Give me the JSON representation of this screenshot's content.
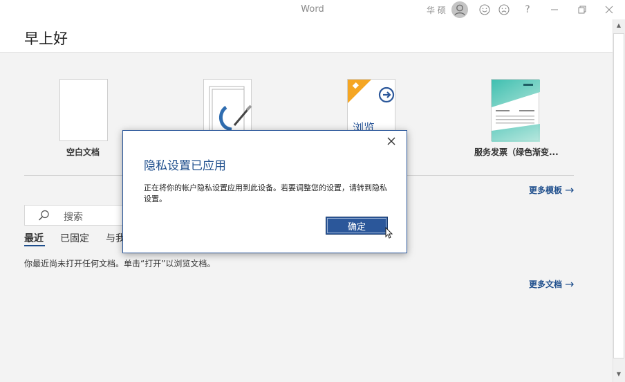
{
  "window": {
    "app_title": "Word",
    "user_name": "华 硕"
  },
  "title_icons": [
    "user-avatar-icon",
    "smile-icon",
    "frown-icon",
    "help-icon",
    "minimize-icon",
    "restore-icon",
    "close-icon"
  ],
  "title_help": "?",
  "greeting": "早上好",
  "templates": [
    {
      "label": "空白文档"
    },
    {
      "label": ""
    },
    {
      "label": "浏览"
    },
    {
      "label": "服务发票（绿色渐变..."
    }
  ],
  "more_templates": "更多模板",
  "search": {
    "placeholder": "搜索"
  },
  "tabs": [
    {
      "label": "最近"
    },
    {
      "label": "已固定"
    },
    {
      "label": "与我"
    }
  ],
  "empty_message": "你最近尚未打开任何文档。单击“打开”以浏览文档。",
  "more_documents": "更多文档",
  "dialog": {
    "title": "隐私设置已应用",
    "message": "正在将你的帐户隐私设置应用到此设备。若要调整您的设置，请转到隐私设置。",
    "ok_label": "确定"
  },
  "colors": {
    "accent": "#2b579a",
    "link": "#1e4e8c",
    "browse_orange": "#f5a623"
  }
}
